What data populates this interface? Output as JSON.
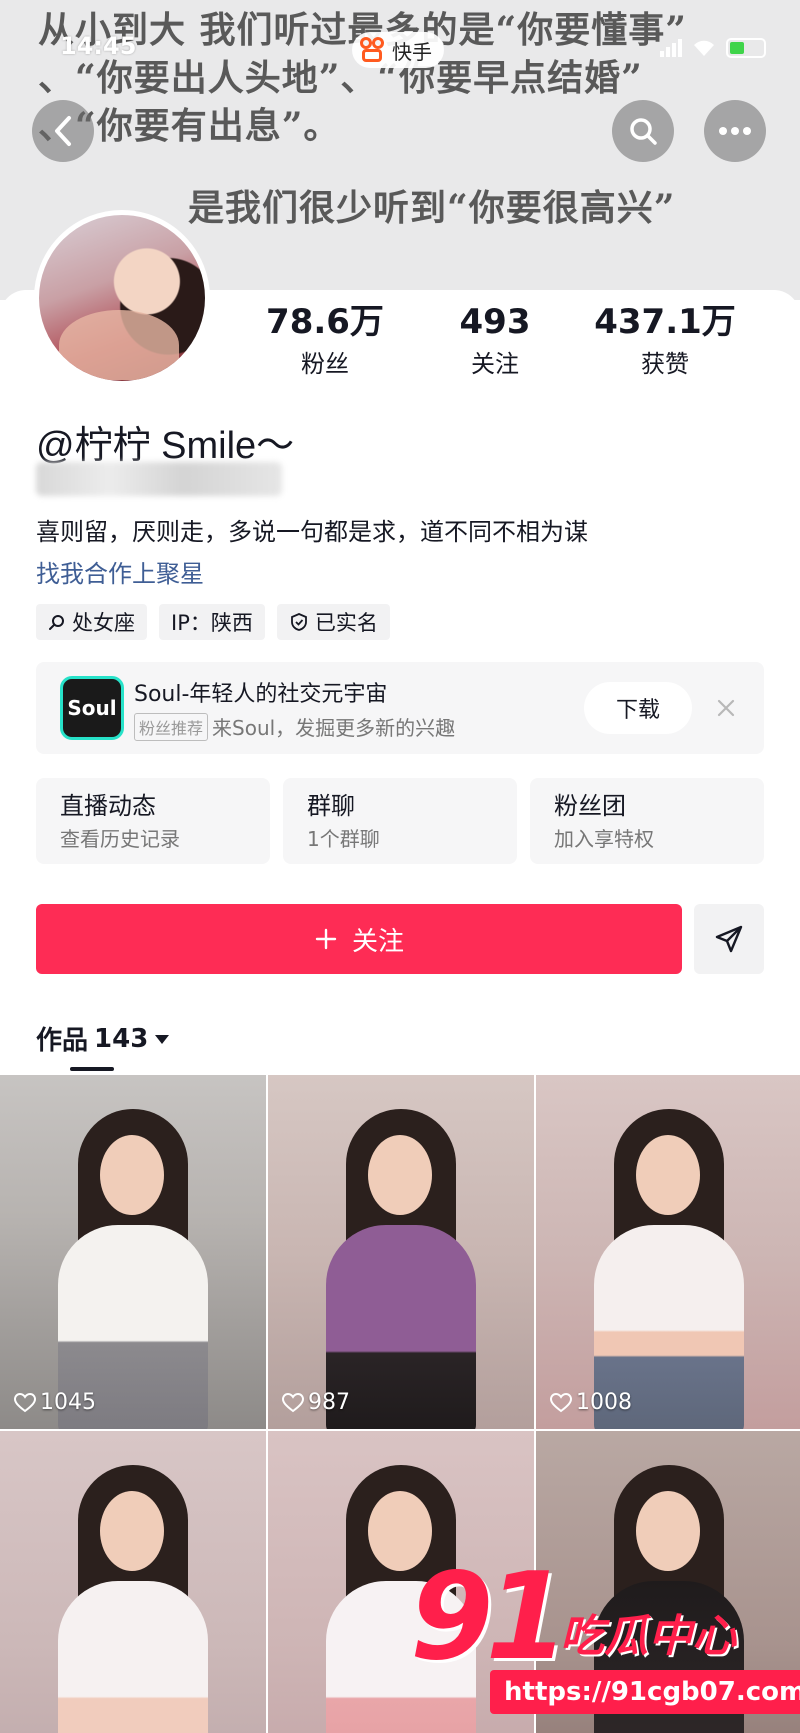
{
  "banner": {
    "lines": [
      "从小到大 我们听过最多的是“你要懂事”",
      "、“你要出人头地”、“你要早点结婚”",
      "、“你要有出息”。",
      "是我们很少听到“你要很高兴”"
    ]
  },
  "status_bar": {
    "time": "14:45",
    "app_name": "快手"
  },
  "header": {
    "back_icon": "back-arrow-icon",
    "search_icon": "search-icon",
    "more_icon": "more-dots-icon"
  },
  "profile": {
    "stats": [
      {
        "value": "78.6万",
        "label": "粉丝"
      },
      {
        "value": "493",
        "label": "关注"
      },
      {
        "value": "437.1万",
        "label": "获赞"
      }
    ],
    "username": "@柠柠 Smile～",
    "bio": "喜则留，厌则走，多说一句都是求，道不同不相为谋",
    "bio_link": "找我合作上聚星",
    "tags": [
      {
        "icon": "search-icon",
        "label": "处女座"
      },
      {
        "icon": "",
        "label": "IP：陕西"
      },
      {
        "icon": "verified-shield-icon",
        "label": "已实名"
      }
    ]
  },
  "ad": {
    "logo_text": "Soul",
    "title": "Soul-年轻人的社交元宇宙",
    "badge": "粉丝推荐",
    "subtitle": "来Soul，发掘更多新的兴趣",
    "download_label": "下载",
    "accent": "#27e2c9"
  },
  "features": [
    {
      "title": "直播动态",
      "sub": "查看历史记录"
    },
    {
      "title": "群聊",
      "sub": "1个群聊"
    },
    {
      "title": "粉丝团",
      "sub": "加入享特权"
    }
  ],
  "actions": {
    "follow_label": "关注",
    "follow_color": "#fe2c55"
  },
  "works": {
    "label": "作品",
    "count": "143",
    "items": [
      {
        "likes": "1045"
      },
      {
        "likes": "987"
      },
      {
        "likes": "1008"
      },
      {
        "likes": ""
      },
      {
        "likes": ""
      },
      {
        "likes": ""
      }
    ]
  },
  "watermark": {
    "number": "91",
    "text": "吃瓜中心",
    "url": "https://91cgb07.com"
  }
}
